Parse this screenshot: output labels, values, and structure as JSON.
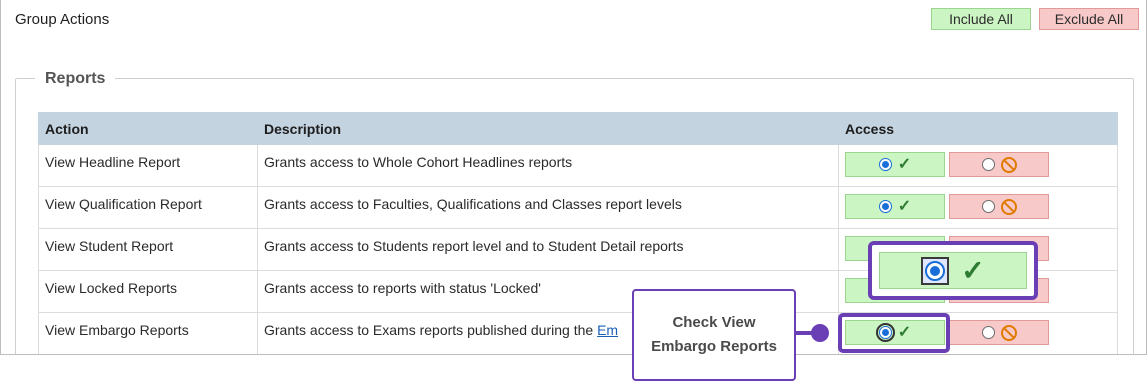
{
  "header": {
    "title": "Group Actions",
    "include_all_label": "Include All",
    "exclude_all_label": "Exclude All"
  },
  "reports": {
    "legend": "Reports",
    "columns": [
      "Action",
      "Description",
      "Access"
    ],
    "rows": [
      {
        "action": "View Headline Report",
        "description": "Grants access to Whole Cohort Headlines reports",
        "access": "include"
      },
      {
        "action": "View Qualification Report",
        "description": "Grants access to Faculties, Qualifications and Classes report levels",
        "access": "include"
      },
      {
        "action": "View Student Report",
        "description": "Grants access to Students report level and to Student Detail reports",
        "access": "include"
      },
      {
        "action": "View Locked Reports",
        "description": "Grants access to reports with status 'Locked'",
        "access": "include"
      },
      {
        "action": "View Embargo Reports",
        "description": "Grants access to Exams reports published during the ",
        "description_link": "Em",
        "access": "include"
      }
    ]
  },
  "callout": {
    "text": "Check View Embargo Reports"
  },
  "colors": {
    "include_bg": "#ccf5c4",
    "exclude_bg": "#f8c9c9",
    "header_bg": "#c4d3e0",
    "callout_accent": "#6a3fb5",
    "radio_blue": "#1a6ed8",
    "check_green": "#2e7d32",
    "ban_orange": "#e07b00"
  },
  "icons": {
    "include": "check-icon",
    "exclude": "ban-icon"
  }
}
